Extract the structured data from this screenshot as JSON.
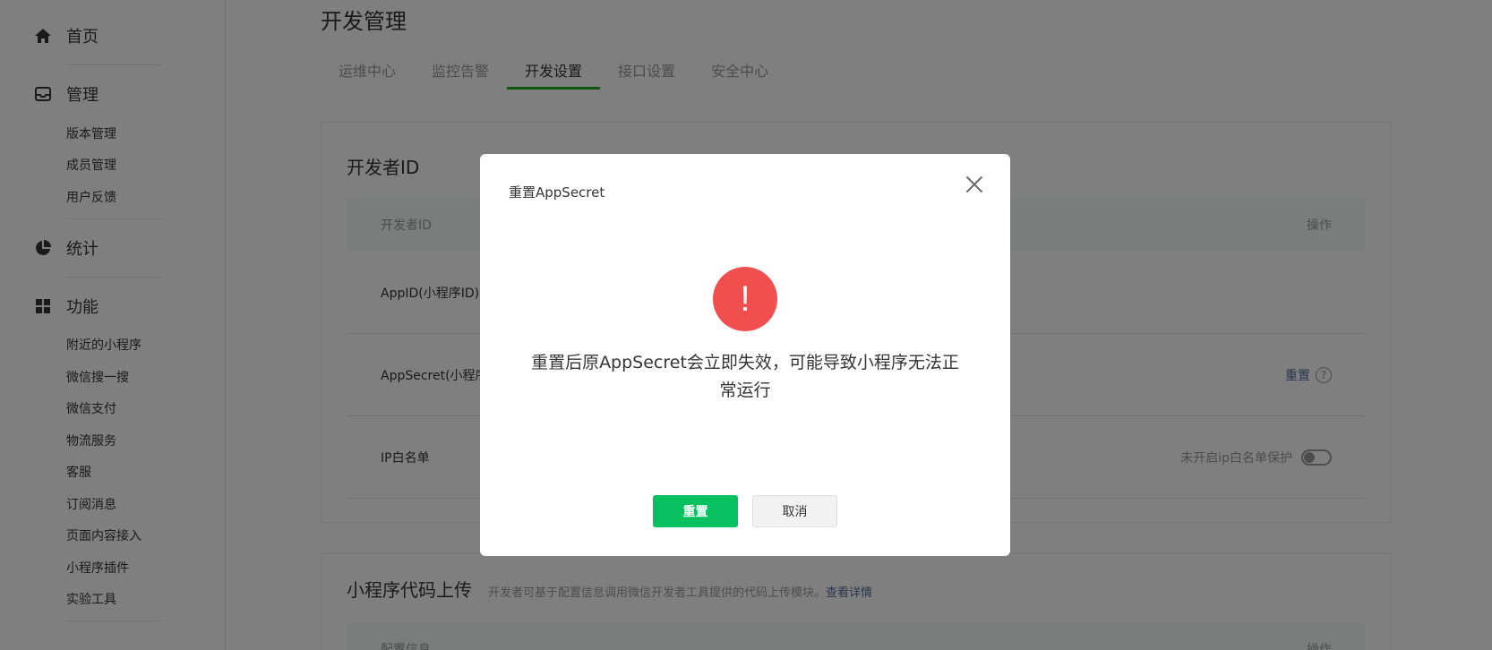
{
  "sidebar": {
    "home": {
      "label": "首页",
      "icon": "home-icon"
    },
    "manage": {
      "label": "管理",
      "icon": "inbox-icon",
      "items": [
        "版本管理",
        "成员管理",
        "用户反馈"
      ]
    },
    "stats": {
      "label": "统计",
      "icon": "pie-chart-icon"
    },
    "features": {
      "label": "功能",
      "icon": "grid-icon",
      "items": [
        "附近的小程序",
        "微信搜一搜",
        "微信支付",
        "物流服务",
        "客服",
        "订阅消息",
        "页面内容接入",
        "小程序插件",
        "实验工具"
      ]
    }
  },
  "page": {
    "title": "开发管理",
    "tabs": [
      {
        "label": "运维中心",
        "active": false
      },
      {
        "label": "监控告警",
        "active": false
      },
      {
        "label": "开发设置",
        "active": true
      },
      {
        "label": "接口设置",
        "active": false
      },
      {
        "label": "安全中心",
        "active": false
      }
    ]
  },
  "developer_card": {
    "title": "开发者ID",
    "header": {
      "col1": "开发者ID",
      "col2": "操作"
    },
    "rows": {
      "appid": {
        "label": "AppID(小程序ID)"
      },
      "secret": {
        "label": "AppSecret(小程序",
        "action": "重置",
        "help": "?"
      },
      "ip": {
        "label": "IP白名单",
        "status": "未开启ip白名单保护"
      }
    }
  },
  "upload_card": {
    "title": "小程序代码上传",
    "desc": "开发者可基于配置信息调用微信开发者工具提供的代码上传模块。",
    "link": "查看详情",
    "header": {
      "col1": "配置信息",
      "col2": "操作"
    }
  },
  "modal": {
    "title": "重置AppSecret",
    "icon_glyph": "!",
    "message": "重置后原AppSecret会立即失效，可能导致小程序无法正常运行",
    "confirm": "重置",
    "cancel": "取消"
  },
  "colors": {
    "accent_green": "#07c160",
    "tab_underline": "#1aad19",
    "warn_red": "#f14f4f",
    "link_blue": "#576b95"
  }
}
